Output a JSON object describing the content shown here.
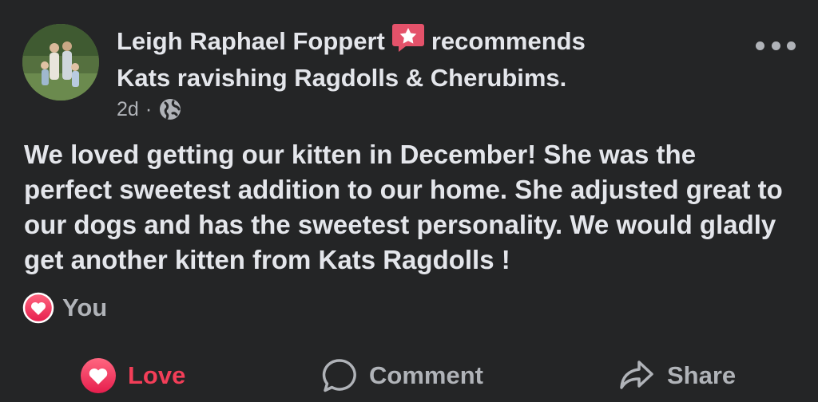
{
  "post": {
    "author_name": "Leigh Raphael Foppert",
    "recommends_text": "recommends",
    "page_name": "Kats ravishing Ragdolls & Cherubims.",
    "timestamp": "2d",
    "separator": "·",
    "body": "We loved getting our kitten in December! She was the perfect sweetest addition to our home. She adjusted great to our dogs and has the sweetest personality. We would gladly get another kitten from Kats Ragdolls !",
    "reactions": {
      "icon": "heart-love-icon",
      "label": "You"
    }
  },
  "actions": {
    "love_label": "Love",
    "comment_label": "Comment",
    "share_label": "Share"
  },
  "colors": {
    "background": "#242526",
    "primary_text": "#e4e6eb",
    "secondary_text": "#b0b3b8",
    "love_red": "#f33e58",
    "badge_red": "#e4526a"
  }
}
